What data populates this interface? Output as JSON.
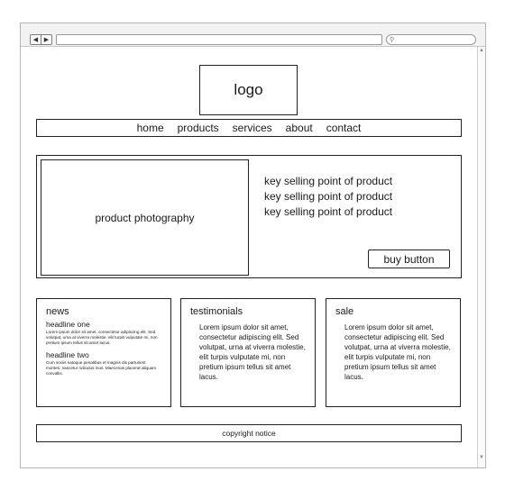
{
  "logo_text": "logo",
  "nav": [
    "home",
    "products",
    "services",
    "about",
    "contact"
  ],
  "hero": {
    "photo_label": "product photography",
    "selling_points": [
      "key selling point of product",
      "key selling point of product",
      "key selling point of product"
    ],
    "buy_label": "buy button"
  },
  "news": {
    "title": "news",
    "items": [
      {
        "headline": "headline one",
        "body": "Lorem ipsum dolor sit amet, consectetur adipiscing elit. Sed volutpat, urna at viverra molestie, elit turpis vulputate mi, non pretium ipsum tellus sit amet lacus."
      },
      {
        "headline": "headline two",
        "body": "Cum sociis natoque penatibus et magnis dis parturient montes, nascetur ridiculus mus. Maecenas placerat aliquam convallis."
      }
    ]
  },
  "testimonials": {
    "title": "testimonials",
    "body": "Lorem ipsum dolor sit amet, consectetur adipiscing elit. Sed volutpat, urna at viverra molestie, elit turpis vulputate mi, non pretium ipsum tellus sit amet lacus."
  },
  "sale": {
    "title": "sale",
    "body": "Lorem ipsum dolor sit amet, consectetur adipiscing elit. Sed volutpat, urna at viverra molestie, elit turpis vulputate mi, non pretium ipsum tellus sit amet lacus."
  },
  "footer_text": "copyright notice",
  "icons": {
    "back": "back-arrow-icon",
    "forward": "forward-arrow-icon",
    "search": "magnifier-icon"
  }
}
